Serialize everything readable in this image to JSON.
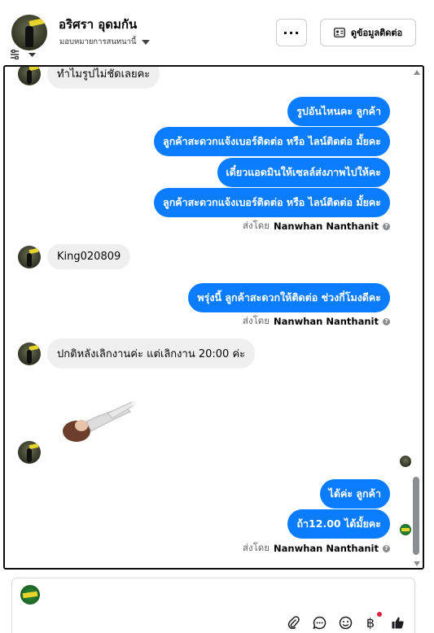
{
  "header": {
    "contact_name": "อริศรา อุดมกัน",
    "assigned_label": "มอบหมายการสนทนานี้",
    "more_label": "···",
    "contact_info_label": "ดูข้อมูลติดต่อ"
  },
  "messages": {
    "top_partial": "ทำไมรูปไม่ชัดเลยคะ",
    "out1": "รูปอันไหนคะ  ลูกค้า",
    "out2": "ลูกค้าสะดวกแจ้งเบอร์ติดต่อ หรือ  ไลน์ติดต่อ มั้ยคะ",
    "out3": "เดี๋ยวแอดมินให้เซลล์ส่งภาพไปให้คะ",
    "out4": "ลูกค้าสะดวกแจ้งเบอร์ติดต่อ หรือ  ไลน์ติดต่อ มั้ยคะ",
    "sent_by_prefix": "ส่งโดย",
    "sender_name": "Nanwhan Nanthanit",
    "in1": "King020809",
    "out5": "พรุ่งนี้ ลูกค้าสะดวกให้ติดต่อ ช่วงกี่โมงดีคะ",
    "in2": "ปกติหลังเลิกงานค่ะ  แต่เลิกงาน 20:00 ค่ะ",
    "out6": "ได้ค่ะ  ลูกค้า",
    "out7": "ถ้า12.00 ได้มั้ยคะ"
  },
  "composer": {
    "tools": [
      "attach-icon",
      "chat-icon",
      "emoji-icon",
      "baht-icon",
      "thumbs-up-icon"
    ]
  },
  "colors": {
    "outgoing_bubble": "#0a7cff",
    "incoming_bubble": "#efefef",
    "panel_border": "#0d0d0d",
    "notification_dot": "#e41e3f"
  }
}
